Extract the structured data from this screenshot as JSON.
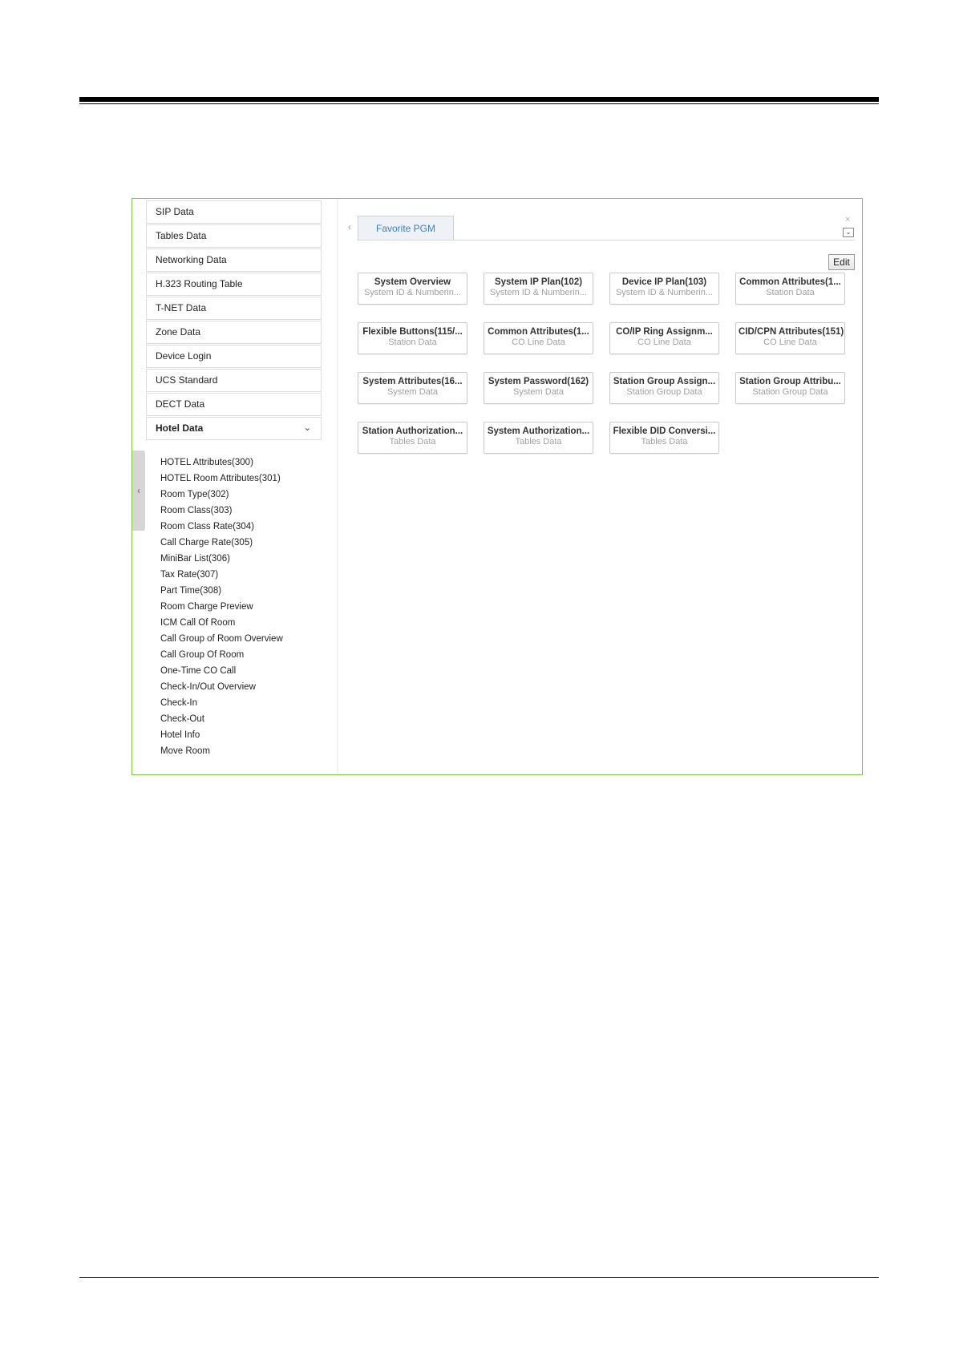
{
  "sidebar": {
    "items": [
      {
        "label": "SIP Data"
      },
      {
        "label": "Tables Data"
      },
      {
        "label": "Networking Data"
      },
      {
        "label": "H.323 Routing Table"
      },
      {
        "label": "T-NET Data"
      },
      {
        "label": "Zone Data"
      },
      {
        "label": "Device Login"
      },
      {
        "label": "UCS Standard"
      },
      {
        "label": "DECT Data"
      },
      {
        "label": "Hotel Data",
        "expanded": true
      }
    ],
    "hotel_subitems": [
      "HOTEL Attributes(300)",
      "HOTEL Room Attributes(301)",
      "Room Type(302)",
      "Room Class(303)",
      "Room Class Rate(304)",
      "Call Charge Rate(305)",
      "MiniBar List(306)",
      "Tax Rate(307)",
      "Part Time(308)",
      "Room Charge Preview",
      "ICM Call Of Room",
      "Call Group of Room Overview",
      "Call Group Of Room",
      "One-Time CO Call",
      "Check-In/Out Overview",
      "Check-In",
      "Check-Out",
      "Hotel Info",
      "Move Room"
    ]
  },
  "main": {
    "tab_label": "Favorite PGM",
    "edit_label": "Edit",
    "close_glyph": "×",
    "dropdown_glyph": "⌄",
    "cards": [
      {
        "title": "System Overview",
        "sub": "System ID & Numberin..."
      },
      {
        "title": "System IP Plan(102)",
        "sub": "System ID & Numberin..."
      },
      {
        "title": "Device IP Plan(103)",
        "sub": "System ID & Numberin..."
      },
      {
        "title": "Common Attributes(1...",
        "sub": "Station Data"
      },
      {
        "title": "Flexible Buttons(115/...",
        "sub": "Station Data"
      },
      {
        "title": "Common Attributes(1...",
        "sub": "CO Line Data"
      },
      {
        "title": "CO/IP Ring Assignm...",
        "sub": "CO Line Data"
      },
      {
        "title": "CID/CPN Attributes(151)",
        "sub": "CO Line Data"
      },
      {
        "title": "System Attributes(16...",
        "sub": "System Data"
      },
      {
        "title": "System Password(162)",
        "sub": "System Data"
      },
      {
        "title": "Station Group Assign...",
        "sub": "Station Group Data"
      },
      {
        "title": "Station Group Attribu...",
        "sub": "Station Group Data"
      },
      {
        "title": "Station Authorization...",
        "sub": "Tables Data"
      },
      {
        "title": "System Authorization...",
        "sub": "Tables Data"
      },
      {
        "title": "Flexible DID Conversi...",
        "sub": "Tables Data"
      }
    ]
  },
  "colors": {
    "frame_border": "#7ac943",
    "tab_text": "#3a7fc0",
    "card_subtitle": "#a0a0a0"
  },
  "icons": {
    "collapse": "chevron-left-icon",
    "scroll_up": "triangle-up-icon",
    "tab_prev": "chevron-left-icon",
    "expanded": "chevron-down-icon",
    "close": "close-icon",
    "dropdown": "chevron-down-icon"
  }
}
